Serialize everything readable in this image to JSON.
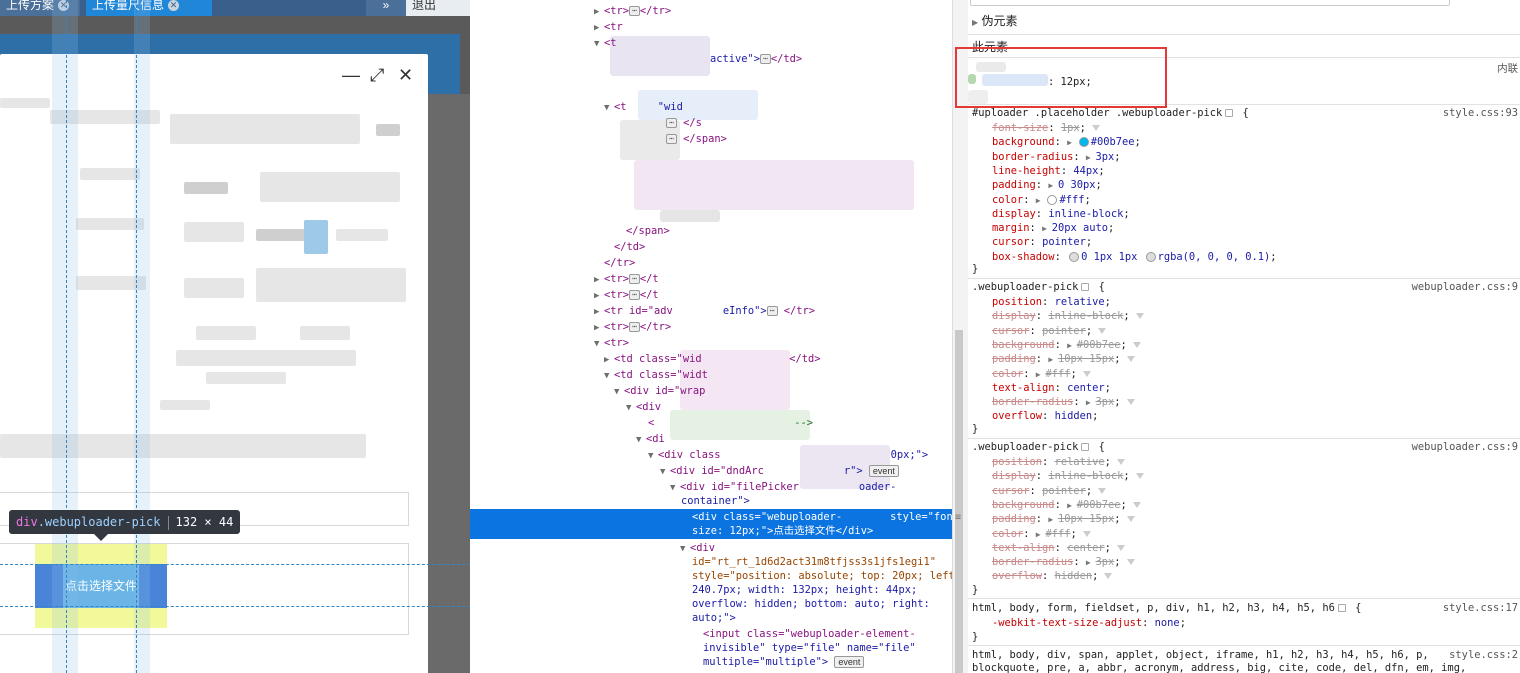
{
  "page_tabs": [
    {
      "label": "上传方案",
      "close": "✕"
    },
    {
      "label": "上传量尺信息",
      "close": "✕"
    }
  ],
  "page_buttons": {
    "forward": "»",
    "logout": "退出"
  },
  "modal": {
    "minimize": "—",
    "maximize": "⤢",
    "close": "✕",
    "pick_button_label": "点击选择文件"
  },
  "tooltip": {
    "tag": "div",
    "class": ".webuploader-pick",
    "size": "132 × 44"
  },
  "dom_tree": {
    "lines": [
      {
        "tri": "▶",
        "pre": "<tr>",
        "dots": true,
        "post": "</tr>"
      },
      {
        "tri": "▶",
        "pre": "<tr",
        "dots": false,
        "post": ""
      },
      {
        "tri": "▼",
        "pre": "<t",
        "dots": false,
        "post": ""
      },
      {
        "tri": "",
        "pre": "",
        "dots": false,
        "post": "active\">",
        "dots2": true,
        "post2": "</td>"
      },
      {
        "tri": "▼",
        "pre": "<t",
        "mid": "\"wid",
        "dots": false,
        "post": ""
      },
      {
        "tri": "",
        "pre": "",
        "dots": true,
        "post": "</s"
      },
      {
        "tri": "",
        "pre": "",
        "dots": true,
        "post": "</span>"
      },
      {
        "tri": "",
        "pre": "</span>",
        "dots": false,
        "post": ""
      },
      {
        "tri": "",
        "pre": "</td>",
        "dots": false,
        "post": ""
      },
      {
        "tri": "",
        "pre": "</tr>",
        "dots": false,
        "post": ""
      },
      {
        "tri": "▶",
        "pre": "<tr>",
        "dots": true,
        "post": "</t"
      },
      {
        "tri": "▶",
        "pre": "<tr>",
        "dots": true,
        "post": "</t"
      },
      {
        "tri": "▶",
        "pre": "<tr id=\"adv",
        "mid": "eInfo\">",
        "dots": true,
        "post": "</tr>"
      },
      {
        "tri": "▶",
        "pre": "<tr>",
        "dots": true,
        "post": "</tr>"
      },
      {
        "tri": "▼",
        "pre": "<tr>",
        "dots": false,
        "post": ""
      },
      {
        "tri": "▶",
        "pre": "<td class=\"wid",
        "dots": false,
        "post": "</td>"
      },
      {
        "tri": "▼",
        "pre": "<td class=\"widt",
        "dots": false,
        "post": ""
      },
      {
        "tri": "▼",
        "pre": "<div id=\"wrap",
        "dots": false,
        "post": ""
      },
      {
        "tri": "▼",
        "pre": "<div",
        "dots": false,
        "post": ""
      },
      {
        "tri": "",
        "pre": "<",
        "dots": false,
        "post": "-->"
      },
      {
        "tri": "▼",
        "pre": "<di",
        "dots": false,
        "post": ""
      },
      {
        "tri": "▼",
        "pre": "<div class",
        "dots": false,
        "post": "0px;\">"
      },
      {
        "tri": "▼",
        "pre": "<div id=\"dndArc",
        "dots": false,
        "post": "r\">",
        "event": true
      },
      {
        "tri": "▼",
        "pre": "<div id=\"filePicker",
        "dots": false,
        "post": "oader-"
      },
      {
        "tri": "",
        "pre": "container\">",
        "dots": false,
        "post": ""
      }
    ],
    "selected_1": "<div class=\"webuploader-",
    "selected_1b": "style=\"font-",
    "selected_2": "size: 12px;\">点击选择文件</div>",
    "after": [
      "<div",
      "id=\"rt_rt_1d6d2act31m8tfjss3s1jfs1egi1\"",
      "style=\"position: absolute; top: 20px; left:",
      "240.7px; width: 132px; height: 44px;",
      "overflow: hidden; bottom: auto; right:",
      "auto;\">",
      "<input class=\"webuploader-element-",
      "invisible\" type=\"file\" name=\"file\"",
      "multiple=\"multiple\">"
    ],
    "event_label": "event",
    "splitter_mark": "≡"
  },
  "styles": {
    "pseudo_label": "伪元素",
    "this_element_label": "此元素",
    "inline_label": "内联",
    "inline_value": ": 12px;",
    "rule1": {
      "selector": "#uploader .placeholder .webuploader-pick",
      "source": "style.css:93",
      "props": [
        {
          "p": "font-size",
          "v": "1px",
          "struck": true
        },
        {
          "p": "background",
          "v": "#00b7ee",
          "color": "#00b7ee"
        },
        {
          "p": "border-radius",
          "v": "3px"
        },
        {
          "p": "line-height",
          "v": "44px"
        },
        {
          "p": "padding",
          "v": "0 30px"
        },
        {
          "p": "color",
          "v": "#fff",
          "color": "#ffffff"
        },
        {
          "p": "display",
          "v": "inline-block"
        },
        {
          "p": "margin",
          "v": "20px auto"
        },
        {
          "p": "cursor",
          "v": "pointer"
        },
        {
          "p": "box-shadow",
          "v": "0 1px 1px ",
          "v2": "rgba(0, 0, 0, 0.1)",
          "color": "#dddddd"
        }
      ]
    },
    "rule2": {
      "selector": ".webuploader-pick",
      "source": "webuploader.css:9",
      "props": [
        {
          "p": "position",
          "v": "relative"
        },
        {
          "p": "display",
          "v": "inline-block",
          "struck": true
        },
        {
          "p": "cursor",
          "v": "pointer",
          "struck": true
        },
        {
          "p": "background",
          "v": "#00b7ee",
          "struck": true
        },
        {
          "p": "padding",
          "v": "10px 15px",
          "struck": true
        },
        {
          "p": "color",
          "v": "#fff",
          "struck": true
        },
        {
          "p": "text-align",
          "v": "center"
        },
        {
          "p": "border-radius",
          "v": "3px",
          "struck": true
        },
        {
          "p": "overflow",
          "v": "hidden"
        }
      ]
    },
    "rule3": {
      "selector": ".webuploader-pick",
      "source": "webuploader.css:9",
      "props": [
        {
          "p": "position",
          "v": "relative",
          "struck": true
        },
        {
          "p": "display",
          "v": "inline-block",
          "struck": true
        },
        {
          "p": "cursor",
          "v": "pointer",
          "struck": true
        },
        {
          "p": "background",
          "v": "#00b7ee",
          "struck": true
        },
        {
          "p": "padding",
          "v": "10px 15px",
          "struck": true
        },
        {
          "p": "color",
          "v": "#fff",
          "struck": true
        },
        {
          "p": "text-align",
          "v": "center",
          "struck": true
        },
        {
          "p": "border-radius",
          "v": "3px",
          "struck": true
        },
        {
          "p": "overflow",
          "v": "hidden",
          "struck": true
        }
      ]
    },
    "rule4": {
      "selector": "html, body, form, fieldset, p, div, h1, h2, h3, h4, h5, h6",
      "source": "style.css:17",
      "props": [
        {
          "p": "-webkit-text-size-adjust",
          "v": "none"
        }
      ]
    },
    "rule5": {
      "selector_1": "html, body, div, span, applet, object, iframe, h1, h2, h3, h4, h5, h6, p,",
      "selector_2": "blockquote, pre, a, abbr, acronym, address, big, cite, code, del, dfn, em, img,",
      "source": "style.css:2"
    },
    "close_brace": "}",
    "open_brace": "{"
  }
}
